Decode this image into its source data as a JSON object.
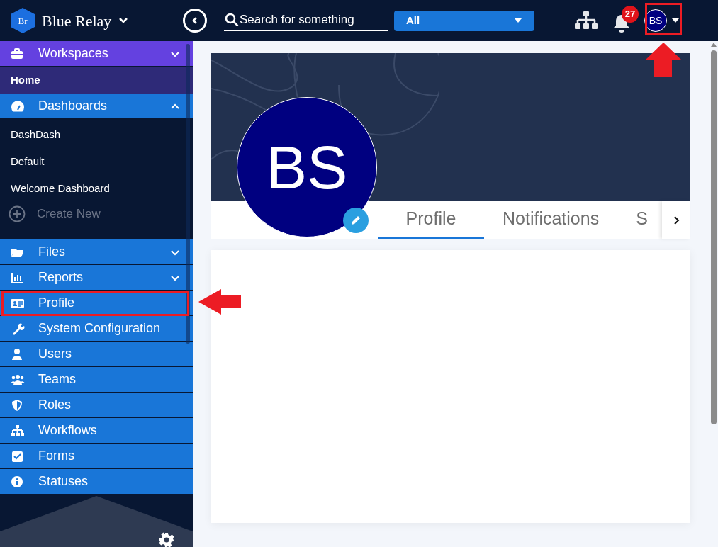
{
  "app": {
    "logo": "Br",
    "name": "Blue Relay"
  },
  "search": {
    "placeholder": "Search for something"
  },
  "scope_dropdown": {
    "value": "All"
  },
  "notifications": {
    "count": "27"
  },
  "user_avatar": {
    "initials": "BS"
  },
  "sidebar": {
    "items": [
      {
        "kind": "group",
        "label": "Workspaces",
        "expanded": false,
        "color": "#6441e0",
        "children": [
          {
            "label": "Home",
            "selected": true
          }
        ]
      },
      {
        "kind": "group",
        "label": "Dashboards",
        "expanded": true,
        "color": "#1976d8",
        "children": [
          {
            "label": "DashDash",
            "selected": false
          },
          {
            "label": "Default",
            "selected": false
          },
          {
            "label": "Welcome Dashboard",
            "selected": false
          }
        ],
        "action": "Create New"
      },
      {
        "kind": "group",
        "label": "Files",
        "expanded": false,
        "color": "#1976d8"
      },
      {
        "kind": "group",
        "label": "Reports",
        "expanded": false,
        "color": "#1976d8"
      },
      {
        "kind": "link",
        "label": "Profile",
        "color": "#1976d8"
      },
      {
        "kind": "link",
        "label": "System Configuration",
        "color": "#1976d8"
      },
      {
        "kind": "link",
        "label": "Users",
        "color": "#1976d8"
      },
      {
        "kind": "link",
        "label": "Teams",
        "color": "#1976d8"
      },
      {
        "kind": "link",
        "label": "Roles",
        "color": "#1976d8"
      },
      {
        "kind": "link",
        "label": "Workflows",
        "color": "#1976d8"
      },
      {
        "kind": "link",
        "label": "Forms",
        "color": "#1976d8"
      },
      {
        "kind": "link",
        "label": "Statuses",
        "color": "#1976d8"
      }
    ]
  },
  "profile": {
    "avatar_initials": "BS",
    "tabs": [
      {
        "label": "Profile",
        "selected": true
      },
      {
        "label": "Notifications",
        "selected": false
      },
      {
        "label": "S",
        "selected": false
      }
    ]
  }
}
